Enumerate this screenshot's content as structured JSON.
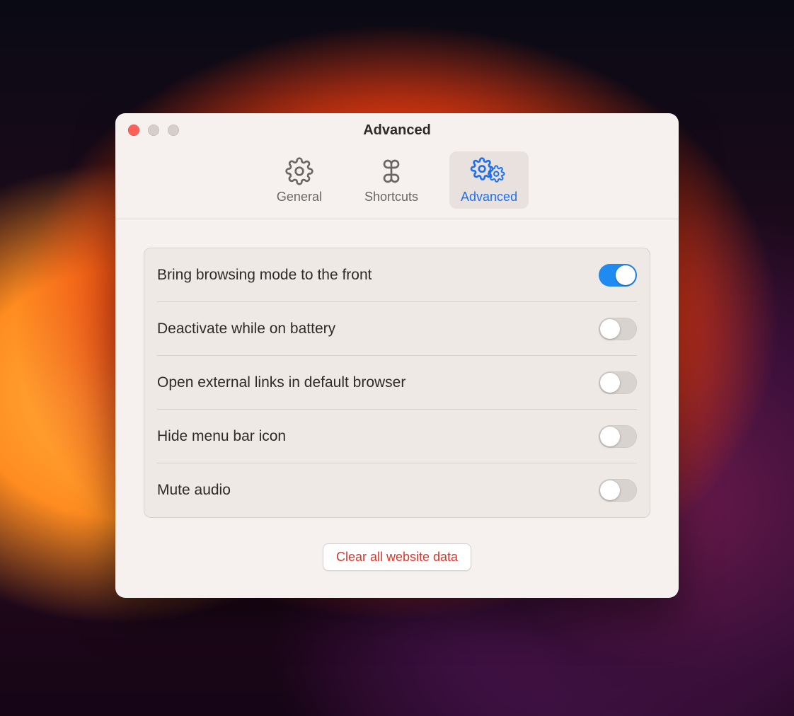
{
  "window": {
    "title": "Advanced"
  },
  "tabs": [
    {
      "label": "General",
      "active": false
    },
    {
      "label": "Shortcuts",
      "active": false
    },
    {
      "label": "Advanced",
      "active": true
    }
  ],
  "settings": [
    {
      "label": "Bring browsing mode to the front",
      "on": true
    },
    {
      "label": "Deactivate while on battery",
      "on": false
    },
    {
      "label": "Open external links in default browser",
      "on": false
    },
    {
      "label": "Hide menu bar icon",
      "on": false
    },
    {
      "label": "Mute audio",
      "on": false
    }
  ],
  "footer": {
    "clear_label": "Clear all website data"
  },
  "colors": {
    "accent": "#1f8bf0",
    "danger": "#e0352b"
  }
}
